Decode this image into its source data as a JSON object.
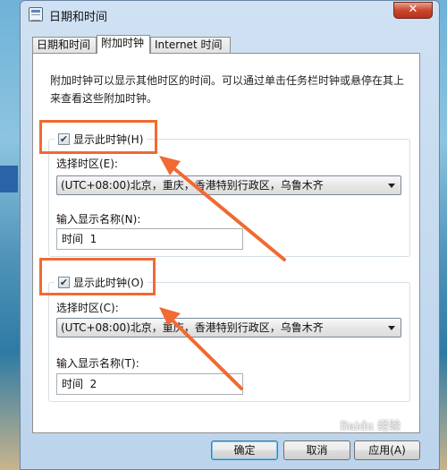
{
  "window": {
    "title": "日期和时间",
    "close_glyph": "✕"
  },
  "tabs": [
    {
      "label": "日期和时间"
    },
    {
      "label": "附加时钟"
    },
    {
      "label": "Internet 时间"
    }
  ],
  "intro_text": "附加时钟可以显示其他时区的时间。可以通过单击任务栏时钟或悬停在其上来查看这些附加时钟。",
  "clock1": {
    "show_label": "显示此时钟(H)",
    "checked": true,
    "timezone_label": "选择时区(E):",
    "timezone_value": "(UTC+08:00)北京，重庆，香港特别行政区，乌鲁木齐",
    "name_label": "输入显示名称(N):",
    "name_value": "时间  1"
  },
  "clock2": {
    "show_label": "显示此时钟(O)",
    "checked": true,
    "timezone_label": "选择时区(C):",
    "timezone_value": "(UTC+08:00)北京，重庆，香港特别行政区，乌鲁木齐",
    "name_label": "输入显示名称(T):",
    "name_value": "时间  2"
  },
  "buttons": {
    "ok": "确定",
    "cancel": "取消",
    "apply": "应用(A)"
  },
  "checkmark_glyph": "✔",
  "annotation_color": "#f06a32",
  "watermark_text": "Baidu 经验"
}
